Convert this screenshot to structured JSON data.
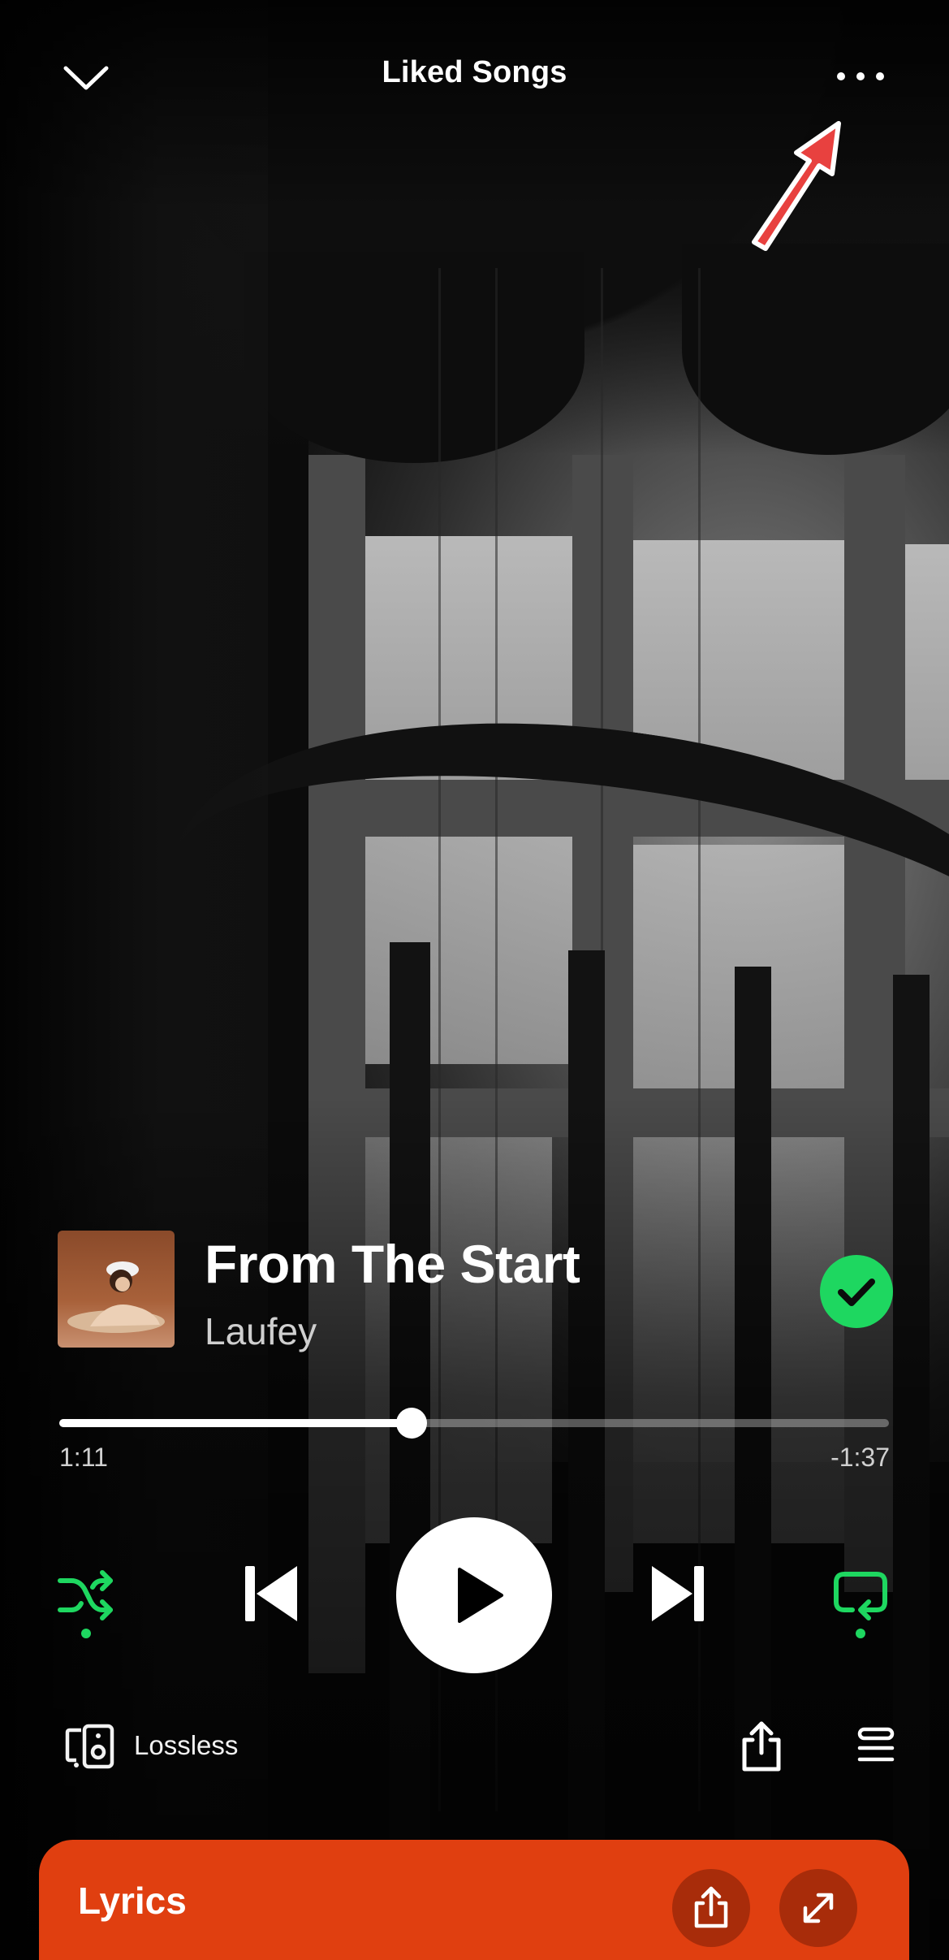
{
  "header": {
    "title": "Liked Songs"
  },
  "track": {
    "title": "From The Start",
    "artist": "Laufey",
    "liked": true
  },
  "playback": {
    "elapsed": "1:11",
    "remaining": "-1:37",
    "progress": 0.425,
    "is_playing": false,
    "shuffle_on": true,
    "repeat_on": true
  },
  "device": {
    "label": "Lossless"
  },
  "lyrics": {
    "title": "Lyrics"
  },
  "colors": {
    "accent": "#1ed760",
    "lyrics_card": "#e03f10",
    "annotation_arrow": "#e8413f"
  },
  "icons": {
    "collapse": "chevron-down-icon",
    "more": "more-options-icon",
    "liked": "check-circle-icon",
    "shuffle": "shuffle-icon",
    "previous": "skip-previous-icon",
    "play": "play-icon",
    "next": "skip-next-icon",
    "repeat": "repeat-icon",
    "device": "speaker-device-icon",
    "share": "share-icon",
    "queue": "queue-icon",
    "expand": "expand-icon"
  }
}
